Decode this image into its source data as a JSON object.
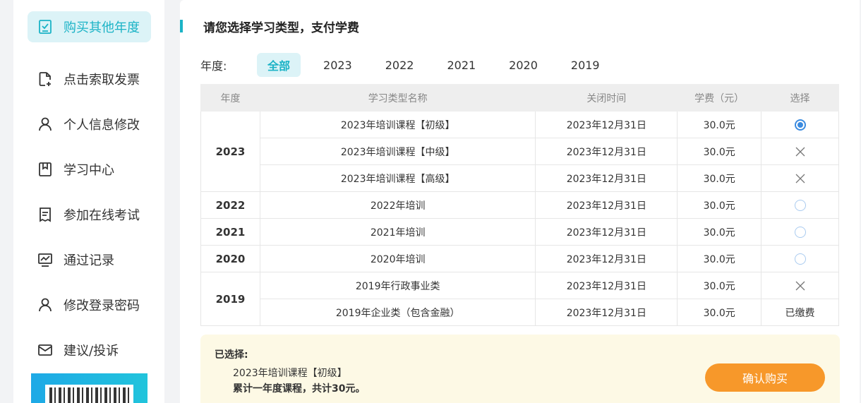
{
  "sidebar": {
    "items": [
      {
        "label": "购买其他年度",
        "icon": "check-doc-icon",
        "active": true
      },
      {
        "label": "点击索取发票",
        "icon": "invoice-icon",
        "active": false
      },
      {
        "label": "个人信息修改",
        "icon": "user-icon",
        "active": false
      },
      {
        "label": "学习中心",
        "icon": "bookmark-icon",
        "active": false
      },
      {
        "label": "参加在线考试",
        "icon": "exam-icon",
        "active": false
      },
      {
        "label": "通过记录",
        "icon": "chart-icon",
        "active": false
      },
      {
        "label": "修改登录密码",
        "icon": "user-lock-icon",
        "active": false
      },
      {
        "label": "建议/投诉",
        "icon": "mail-icon",
        "active": false
      }
    ]
  },
  "main": {
    "title": "请您选择学习类型，支付学费",
    "year_label": "年度:",
    "year_tabs": [
      {
        "label": "全部",
        "active": true
      },
      {
        "label": "2023",
        "active": false
      },
      {
        "label": "2022",
        "active": false
      },
      {
        "label": "2021",
        "active": false
      },
      {
        "label": "2020",
        "active": false
      },
      {
        "label": "2019",
        "active": false
      }
    ],
    "table": {
      "headers": [
        "年度",
        "学习类型名称",
        "关闭时间",
        "学费（元）",
        "选择"
      ],
      "rows": [
        {
          "year": "2023",
          "name": "2023年培训课程【初级】",
          "close": "2023年12月31日",
          "fee": "30.0元",
          "select": "selected"
        },
        {
          "year": "",
          "name": "2023年培训课程【中级】",
          "close": "2023年12月31日",
          "fee": "30.0元",
          "select": "disabled"
        },
        {
          "year": "",
          "name": "2023年培训课程【高级】",
          "close": "2023年12月31日",
          "fee": "30.0元",
          "select": "disabled"
        },
        {
          "year": "2022",
          "name": "2022年培训",
          "close": "2023年12月31日",
          "fee": "30.0元",
          "select": "unselected"
        },
        {
          "year": "2021",
          "name": "2021年培训",
          "close": "2023年12月31日",
          "fee": "30.0元",
          "select": "unselected"
        },
        {
          "year": "2020",
          "name": "2020年培训",
          "close": "2023年12月31日",
          "fee": "30.0元",
          "select": "unselected"
        },
        {
          "year": "2019",
          "name": "2019年行政事业类",
          "close": "2023年12月31日",
          "fee": "30.0元",
          "select": "disabled"
        },
        {
          "year": "",
          "name": "2019年企业类（包含金融）",
          "close": "2023年12月31日",
          "fee": "30.0元",
          "select": "已缴费"
        }
      ]
    }
  },
  "summary": {
    "title": "已选择:",
    "selected_item": "2023年培训课程【初级】",
    "total": "累计一年度课程，共计30元。",
    "buy_label": "确认购买"
  },
  "colors": {
    "accent": "#1bb3c6",
    "accent_bg": "#dcf3f7",
    "button": "#f7982a",
    "summary_bg": "#fdf9e5",
    "radio": "#3b8be0"
  }
}
